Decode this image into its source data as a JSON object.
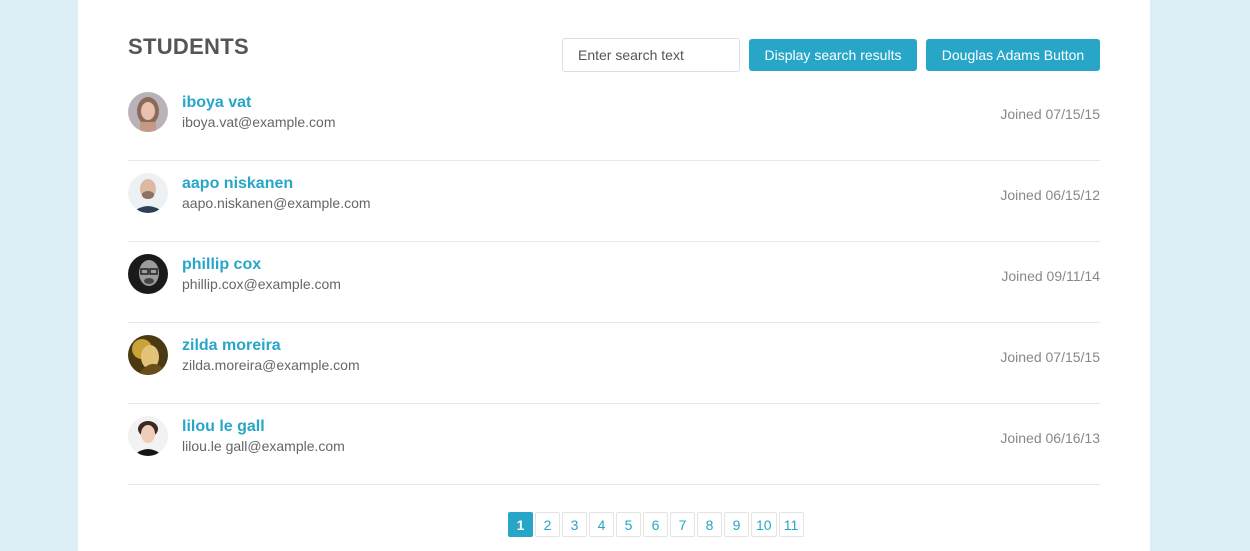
{
  "header": {
    "title": "STUDENTS",
    "search_placeholder": "Enter search text",
    "display_button": "Display search results",
    "douglas_button": "Douglas Adams Button"
  },
  "students": [
    {
      "name": "iboya vat",
      "email": "iboya.vat@example.com",
      "joined": "Joined 07/15/15",
      "avatar": "portrait-woman-icon"
    },
    {
      "name": "aapo niskanen",
      "email": "aapo.niskanen@example.com",
      "joined": "Joined 06/15/12",
      "avatar": "portrait-bald-man-icon"
    },
    {
      "name": "phillip cox",
      "email": "phillip.cox@example.com",
      "joined": "Joined 09/11/14",
      "avatar": "portrait-man-glasses-icon"
    },
    {
      "name": "zilda moreira",
      "email": "zilda.moreira@example.com",
      "joined": "Joined 07/15/15",
      "avatar": "portrait-woman-golden-icon"
    },
    {
      "name": "lilou le gall",
      "email": "lilou.le gall@example.com",
      "joined": "Joined 06/16/13",
      "avatar": "portrait-woman-smiling-icon"
    }
  ],
  "pagination": {
    "current": "1",
    "pages": [
      "1",
      "2",
      "3",
      "4",
      "5",
      "6",
      "7",
      "8",
      "9",
      "10",
      "11"
    ]
  },
  "colors": {
    "accent": "#27a6c8",
    "background": "#dceff6"
  }
}
